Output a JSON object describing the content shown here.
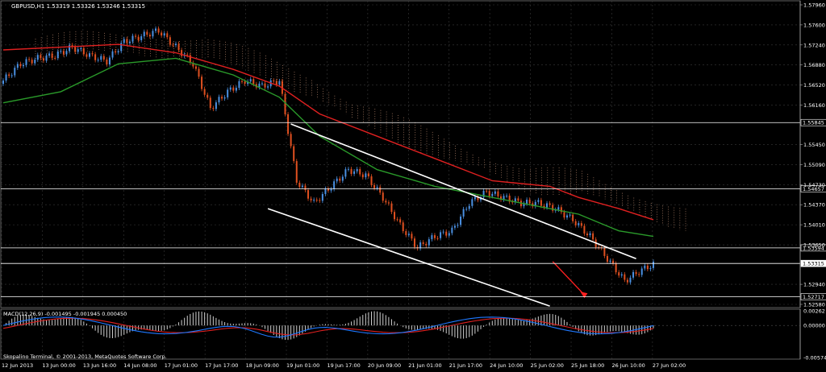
{
  "chart_data": [
    {
      "type": "line",
      "title": "GBPUSD,H1  1.53319 1.53326 1.53246 1.53315",
      "symbol": "GBPUSD",
      "timeframe": "H1",
      "ohlc_last": {
        "open": 1.53319,
        "high": 1.53326,
        "low": 1.53246,
        "close": 1.53315
      },
      "ylim": [
        1.5258,
        1.5796
      ],
      "y_ticks": [
        1.5796,
        1.576,
        1.5724,
        1.5688,
        1.5652,
        1.5616,
        1.5545,
        1.5509,
        1.5473,
        1.5437,
        1.5401,
        1.5365,
        1.5294,
        1.5258
      ],
      "x_ticks": [
        "12 Jun 2013",
        "13 Jun 00:00",
        "13 Jun 16:00",
        "14 Jun 08:00",
        "17 Jun 01:00",
        "17 Jun 17:00",
        "18 Jun 09:00",
        "19 Jun 01:00",
        "19 Jun 17:00",
        "20 Jun 09:00",
        "21 Jun 01:00",
        "21 Jun 17:00",
        "24 Jun 10:00",
        "25 Jun 02:00",
        "25 Jun 18:00",
        "26 Jun 10:00",
        "27 Jun 02:00"
      ],
      "horizontal_levels": [
        1.55845,
        1.54657,
        1.53594,
        1.53315,
        1.52717
      ],
      "price_label_colors": {
        "1.53315": "#ffffff"
      },
      "grid": true,
      "series": [
        {
          "kind": "close",
          "color": "#4a90e2",
          "x": [
            0,
            6,
            12,
            18,
            24,
            30,
            36,
            42,
            48,
            54,
            60,
            66,
            72,
            78,
            84,
            90,
            96,
            102,
            108,
            114,
            120,
            126,
            132,
            138,
            144,
            150,
            156,
            162,
            168,
            174,
            180,
            186,
            192,
            198,
            204,
            210,
            216,
            222,
            226
          ],
          "values": [
            1.566,
            1.569,
            1.57,
            1.5705,
            1.572,
            1.5705,
            1.5695,
            1.573,
            1.574,
            1.575,
            1.572,
            1.569,
            1.561,
            1.564,
            1.566,
            1.565,
            1.566,
            1.548,
            1.544,
            1.547,
            1.55,
            1.549,
            1.545,
            1.54,
            1.536,
            1.538,
            1.539,
            1.544,
            1.546,
            1.545,
            1.544,
            1.544,
            1.543,
            1.541,
            1.538,
            1.534,
            1.53,
            1.532,
            1.533
          ]
        },
        {
          "kind": "ma_slow",
          "color": "#e02020",
          "x": [
            0,
            20,
            40,
            60,
            80,
            96,
            110,
            130,
            150,
            170,
            190,
            200,
            214,
            226
          ],
          "values": [
            1.5715,
            1.572,
            1.5725,
            1.571,
            1.568,
            1.565,
            1.56,
            1.556,
            1.552,
            1.548,
            1.547,
            1.545,
            1.543,
            1.541
          ]
        },
        {
          "kind": "ma_mid",
          "color": "#2a9a2a",
          "x": [
            0,
            20,
            40,
            60,
            80,
            96,
            110,
            130,
            150,
            170,
            190,
            200,
            214,
            226
          ],
          "values": [
            1.562,
            1.564,
            1.569,
            1.57,
            1.567,
            1.563,
            1.556,
            1.55,
            1.547,
            1.545,
            1.543,
            1.542,
            1.539,
            1.538
          ]
        },
        {
          "kind": "channel_upper",
          "color": "#ffffff",
          "x": [
            100,
            220
          ],
          "values": [
            1.5582,
            1.534
          ]
        },
        {
          "kind": "channel_lower",
          "color": "#ffffff",
          "x": [
            92,
            190
          ],
          "values": [
            1.543,
            1.5255
          ]
        },
        {
          "kind": "forecast",
          "color": "#ff2020",
          "x": [
            191,
            202
          ],
          "values": [
            1.5335,
            1.5275
          ]
        }
      ]
    },
    {
      "type": "bar",
      "title": "MACD(12,26,9) -0.001495 -0.001945 0.000450",
      "ylim": [
        -0.00574,
        0.00262
      ],
      "y_ticks": [
        0.00262,
        0.0,
        -0.00574
      ],
      "series": [
        {
          "name": "MACD",
          "color": "#1e78ff"
        },
        {
          "name": "Signal",
          "color": "#e02020"
        }
      ]
    }
  ],
  "footer": {
    "copyright": "Skopalino Terminal, © 2001-2013, MetaQuotes Software Corp."
  },
  "colors": {
    "background": "#000000",
    "grid": "#3a3a3a",
    "text": "#ffffff",
    "bull": "#4a90e2",
    "bear": "#e05020",
    "cloud": "#d9a080"
  }
}
